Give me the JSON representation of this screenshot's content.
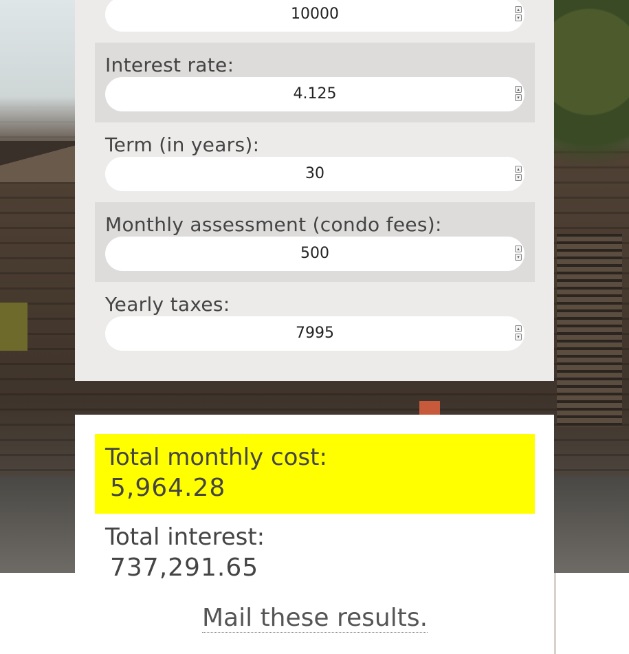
{
  "form": {
    "fields": [
      {
        "label": "",
        "value": "10000"
      },
      {
        "label": "Interest rate:",
        "value": "4.125"
      },
      {
        "label": "Term (in years):",
        "value": "30"
      },
      {
        "label": "Monthly assessment (condo fees):",
        "value": "500"
      },
      {
        "label": "Yearly taxes:",
        "value": "7995"
      }
    ]
  },
  "results": {
    "monthly": {
      "label": "Total monthly cost:",
      "value": "5,964.28"
    },
    "interest": {
      "label": "Total interest:",
      "value": "737,291.65"
    },
    "mail_link": "Mail these results."
  },
  "colors": {
    "highlight": "#ffff00",
    "form_bg": "#ecebea",
    "field_shade": "#dddcdb",
    "text": "#444444"
  },
  "icons": {
    "spinner_up": "chevron-up-icon",
    "spinner_down": "chevron-down-icon"
  }
}
